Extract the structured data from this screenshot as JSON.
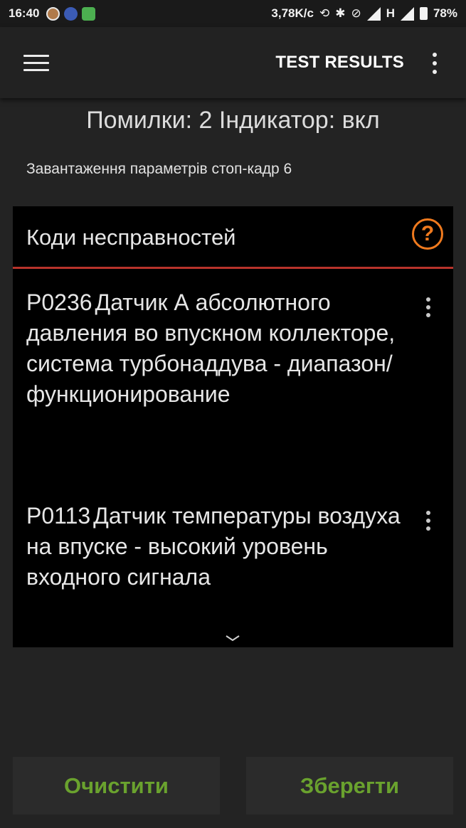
{
  "status_bar": {
    "time": "16:40",
    "network_speed": "3,78K/c",
    "network_type": "H",
    "battery": "78%",
    "icons": [
      "coin-app-icon",
      "facebook-icon",
      "maps-icon",
      "sync-icon",
      "bluetooth-icon",
      "vibrate-off-icon",
      "signal-icon",
      "battery-icon"
    ]
  },
  "appbar": {
    "title": "TEST RESULTS"
  },
  "summary": {
    "text": "Помилки: 2 Індикатор: вкл"
  },
  "freeze_frame": {
    "text": "Завантаження параметрів стоп-кадр 6"
  },
  "card": {
    "title": "Коди несправностей",
    "accent_color": "#b8332b",
    "help_icon_color": "#f07a1e",
    "help_glyph": "?",
    "items": [
      {
        "code": "P0236",
        "description": "Датчик А абсолютного давления во впускном коллекторе, система турбонаддува - диапазон/ функционирование"
      },
      {
        "code": "P0113",
        "description": "Датчик температуры воздуха на впуске - высокий уровень входного сигнала"
      }
    ]
  },
  "buttons": {
    "clear": "Очистити",
    "save": "Зберегти",
    "text_color": "#6aa22e"
  }
}
